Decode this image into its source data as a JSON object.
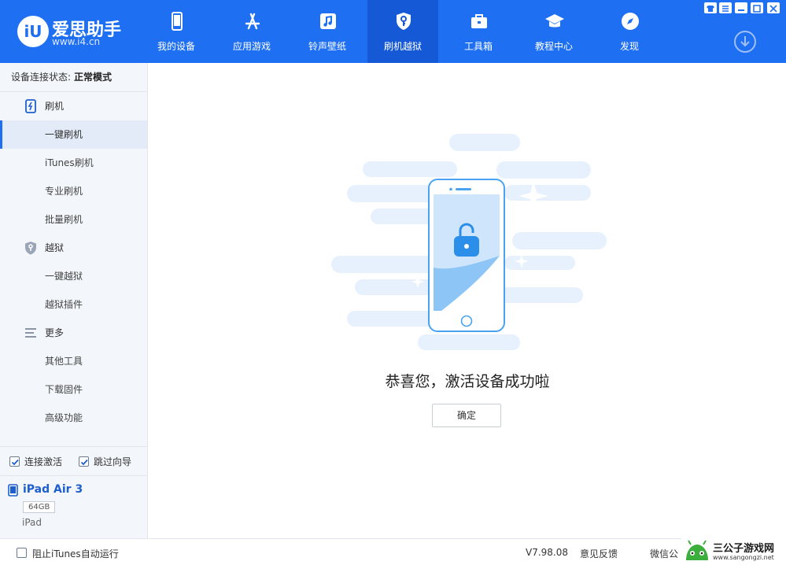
{
  "app": {
    "logo_badge": "iU",
    "logo_title": "爱思助手",
    "logo_url": "www.i4.cn"
  },
  "nav": [
    {
      "label": "我的设备",
      "icon": "phone-icon"
    },
    {
      "label": "应用游戏",
      "icon": "app-store-icon"
    },
    {
      "label": "铃声壁纸",
      "icon": "music-note-icon"
    },
    {
      "label": "刷机越狱",
      "icon": "shield-key-icon",
      "active": true
    },
    {
      "label": "工具箱",
      "icon": "toolbox-icon"
    },
    {
      "label": "教程中心",
      "icon": "graduation-cap-icon"
    },
    {
      "label": "发现",
      "icon": "compass-icon"
    }
  ],
  "window_controls": [
    "shirt-icon",
    "menu-icon",
    "minimize-icon",
    "maximize-icon",
    "close-icon"
  ],
  "sidebar": {
    "status_label": "设备连接状态:",
    "status_value": "正常模式",
    "groups": [
      {
        "label": "刷机",
        "icon": "flash-phone-icon",
        "items": [
          "一键刷机",
          "iTunes刷机",
          "专业刷机",
          "批量刷机"
        ]
      },
      {
        "label": "越狱",
        "icon": "shield-key-icon",
        "items": [
          "一键越狱",
          "越狱插件"
        ]
      },
      {
        "label": "更多",
        "icon": "list-icon",
        "items": [
          "其他工具",
          "下载固件",
          "高级功能"
        ]
      }
    ],
    "active_item": "一键刷机",
    "checks": [
      {
        "label": "连接激活",
        "checked": true
      },
      {
        "label": "跳过向导",
        "checked": true
      }
    ],
    "device": {
      "name": "iPad Air 3",
      "capacity": "64GB",
      "type": "iPad"
    }
  },
  "main": {
    "success_message": "恭喜您，激活设备成功啦",
    "ok_button": "确定"
  },
  "statusbar": {
    "itunes_check_label": "阻止iTunes自动运行",
    "itunes_checked": false,
    "version": "V7.98.08",
    "feedback": "意见反馈",
    "wechat": "微信公"
  },
  "watermark": {
    "title": "三公子游戏网",
    "url": "www.sangongzi.net"
  },
  "colors": {
    "accent": "#1e6ff2",
    "nav_active": "#1659d6",
    "sidebar_bg": "#f3f6fa",
    "illustration_blue": "#4aa3f0"
  }
}
